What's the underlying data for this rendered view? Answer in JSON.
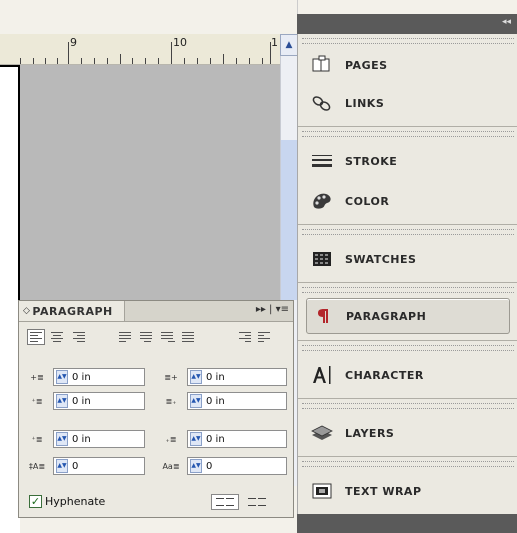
{
  "ruler": {
    "marks": [
      "9",
      "10",
      "1"
    ]
  },
  "dock": {
    "collapse_glyph": "◂◂",
    "items": [
      {
        "label": "PAGES",
        "icon": "pages-icon"
      },
      {
        "label": "LINKS",
        "icon": "links-icon"
      },
      {
        "label": "STROKE",
        "icon": "stroke-icon"
      },
      {
        "label": "COLOR",
        "icon": "color-palette-icon"
      },
      {
        "label": "SWATCHES",
        "icon": "swatches-icon"
      },
      {
        "label": "PARAGRAPH",
        "icon": "pilcrow-icon",
        "active": true
      },
      {
        "label": "CHARACTER",
        "icon": "character-icon"
      },
      {
        "label": "LAYERS",
        "icon": "layers-icon"
      },
      {
        "label": "TEXT WRAP",
        "icon": "text-wrap-icon"
      }
    ]
  },
  "paragraph": {
    "title": "PARAGRAPH",
    "title_glyph": "◇",
    "menu_glyph": "▸▸ | ▾≡",
    "left_indent": "0 in",
    "right_indent": "0 in",
    "first_line_indent": "0 in",
    "last_line_indent": "0 in",
    "space_before": "0 in",
    "space_after": "0 in",
    "drop_cap_lines": "0",
    "drop_cap_chars": "0",
    "hyphenate_label": "Hyphenate",
    "hyphenate_checked": true
  }
}
